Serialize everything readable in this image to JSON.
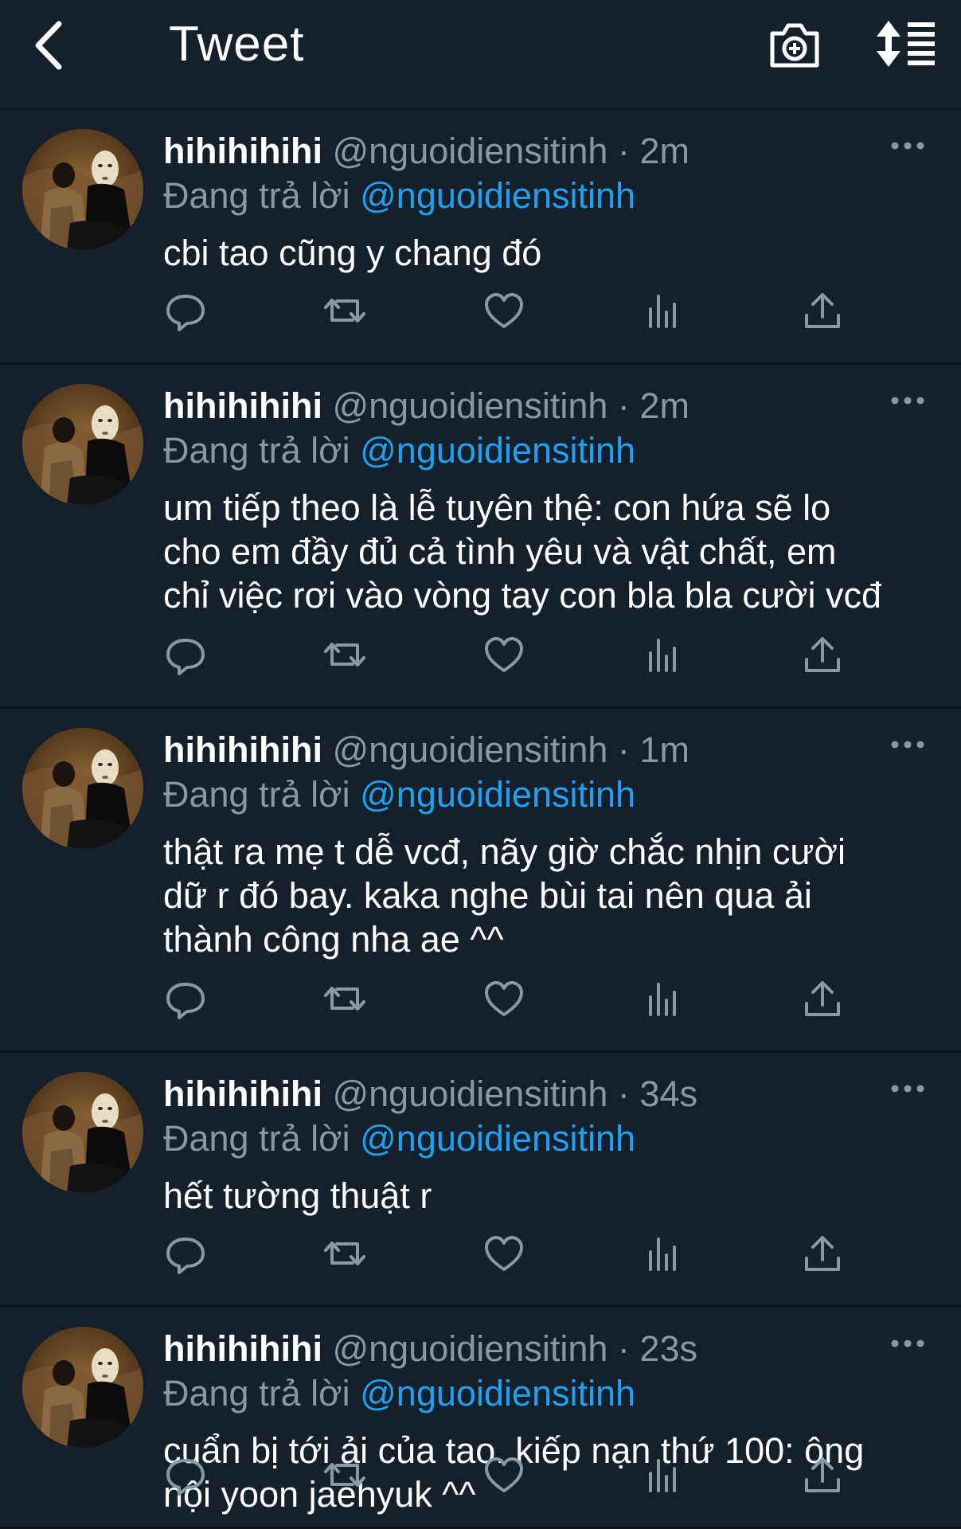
{
  "header": {
    "title": "Tweet",
    "icons": {
      "back": "chevron-left-icon",
      "camera": "camera-plus-icon",
      "sort": "sort-icon"
    }
  },
  "colors": {
    "background": "#15202b",
    "divider": "#0f1419",
    "secondary_text": "#8899a6",
    "accent": "#1da1f2"
  },
  "tweets": [
    {
      "name": "hihihihihi",
      "handle": "@nguoidiensitinh",
      "separator": "·",
      "time": "2m",
      "replying_label": "Đang trả lời",
      "replying_to": "@nguoidiensitinh",
      "text": "cbi tao cũng y chang đó"
    },
    {
      "name": "hihihihihi",
      "handle": "@nguoidiensitinh",
      "separator": "·",
      "time": "2m",
      "replying_label": "Đang trả lời",
      "replying_to": "@nguoidiensitinh",
      "text": "um tiếp theo là lễ tuyên thệ: con hứa sẽ lo\ncho em đầy đủ cả tình yêu và vật chất, em\nchỉ việc rơi vào vòng tay con bla bla cười vcđ"
    },
    {
      "name": "hihihihihi",
      "handle": "@nguoidiensitinh",
      "separator": "·",
      "time": "1m",
      "replying_label": "Đang trả lời",
      "replying_to": "@nguoidiensitinh",
      "text": "thật ra mẹ t dễ vcđ, nãy giờ chắc nhịn cười\ndữ r đó bay. kaka nghe bùi tai nên qua ải\nthành công nha ae ^^"
    },
    {
      "name": "hihihihihi",
      "handle": "@nguoidiensitinh",
      "separator": "·",
      "time": "34s",
      "replying_label": "Đang trả lời",
      "replying_to": "@nguoidiensitinh",
      "text": "hết tường thuật r"
    },
    {
      "name": "hihihihihi",
      "handle": "@nguoidiensitinh",
      "separator": "·",
      "time": "23s",
      "replying_label": "Đang trả lời",
      "replying_to": "@nguoidiensitinh",
      "text": "cuẩn bị tới ải của tao. kiếp nạn thứ 100: ông\nnội yoon jaehyuk ^^"
    }
  ],
  "action_icons": [
    "reply-icon",
    "retweet-icon",
    "like-icon",
    "analytics-icon",
    "share-icon"
  ]
}
